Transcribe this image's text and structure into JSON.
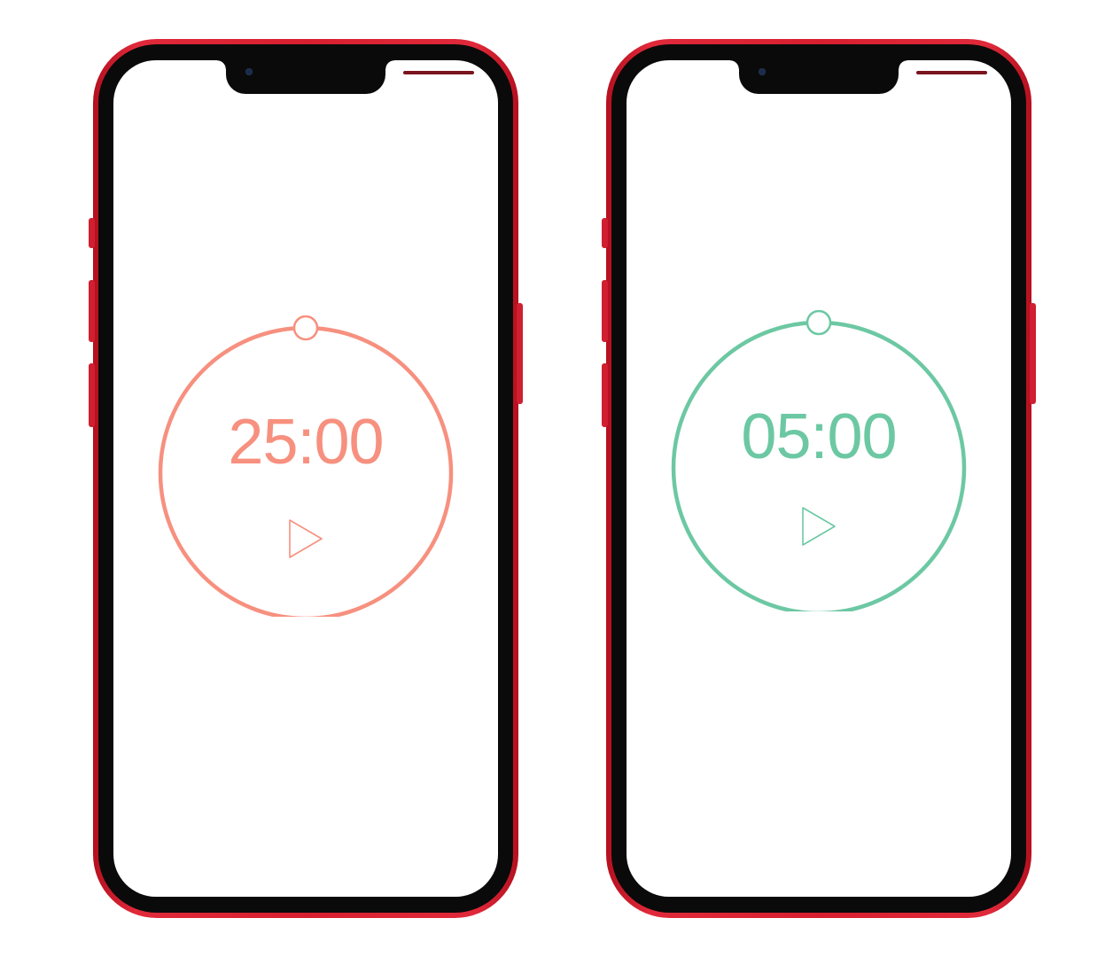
{
  "colors": {
    "work_accent": "#f7907f",
    "break_accent": "#6cc8a3",
    "phone_frame": "#d81f30"
  },
  "phones": [
    {
      "mode": "work",
      "time": "25:00",
      "progress": 0,
      "play_icon": "play-icon"
    },
    {
      "mode": "break",
      "time": "05:00",
      "progress": 0,
      "play_icon": "play-icon"
    }
  ]
}
